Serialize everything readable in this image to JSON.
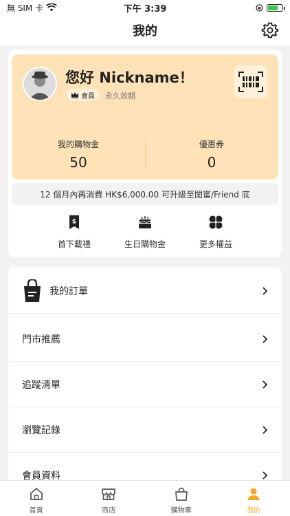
{
  "status_bar": {
    "carrier": "無 SIM 卡",
    "time": "下午 3:39"
  },
  "nav": {
    "title": "我的"
  },
  "member": {
    "greeting": "您好 Nickname！",
    "badge": "會員",
    "validity": "永久效期",
    "stats": [
      {
        "label": "我的購物金",
        "value": "50"
      },
      {
        "label": "優惠券",
        "value": "0"
      }
    ],
    "upgrade_text": "12 個月內再消費 HK$6,000.00 可升級至閨蜜/Friend 底",
    "accent_color": "#fde2b7"
  },
  "perks": [
    {
      "label": "首下載禮",
      "icon": "dollar-bookmark-icon"
    },
    {
      "label": "生日購物金",
      "icon": "birthday-cake-icon"
    },
    {
      "label": "更多權益",
      "icon": "four-petal-icon"
    }
  ],
  "menu": [
    {
      "label": "我的訂單",
      "icon": "shopping-bag-icon"
    },
    {
      "label": "門市推薦"
    },
    {
      "label": "追蹤清單"
    },
    {
      "label": "瀏覽記錄"
    },
    {
      "label": "會員資料"
    }
  ],
  "tabs": [
    {
      "label": "首頁",
      "icon": "home-icon",
      "active": false
    },
    {
      "label": "商店",
      "icon": "store-icon",
      "active": false
    },
    {
      "label": "購物車",
      "icon": "bag-icon",
      "active": false
    },
    {
      "label": "我的",
      "icon": "user-icon",
      "active": true
    }
  ],
  "active_color": "#f5a623"
}
